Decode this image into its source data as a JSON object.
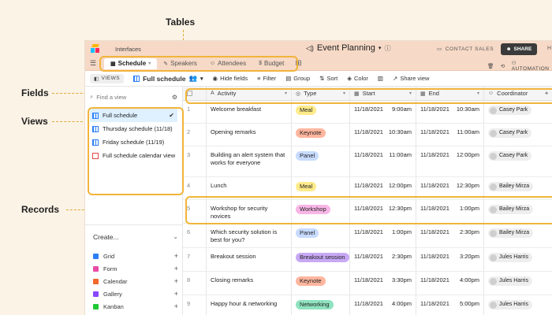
{
  "callouts": {
    "tables": "Tables",
    "fields": "Fields",
    "views": "Views",
    "records": "Records"
  },
  "topbar": {
    "interfaces": "Interfaces",
    "title": "Event Planning",
    "contact": "CONTACT SALES",
    "share": "SHARE",
    "help": "H"
  },
  "tabs": [
    {
      "label": "Schedule",
      "active": true
    },
    {
      "label": "Speakers",
      "active": false
    },
    {
      "label": "Attendees",
      "active": false
    },
    {
      "label": "Budget",
      "active": false
    }
  ],
  "automations": "AUTOMATION",
  "toolbar": {
    "views": "VIEWS",
    "view_name": "Full schedule",
    "hide": "Hide fields",
    "filter": "Filter",
    "group": "Group",
    "sort": "Sort",
    "color": "Color",
    "share_view": "Share view"
  },
  "sidebar": {
    "find_placeholder": "Find a view",
    "views": [
      {
        "label": "Full schedule",
        "selected": true,
        "type": "grid"
      },
      {
        "label": "Thursday schedule (11/18)",
        "selected": false,
        "type": "grid"
      },
      {
        "label": "Friday schedule (11/19)",
        "selected": false,
        "type": "grid"
      },
      {
        "label": "Full schedule calendar view",
        "selected": false,
        "type": "calendar"
      }
    ],
    "create": "Create...",
    "create_items": [
      {
        "label": "Grid",
        "color": "#2d7ff9"
      },
      {
        "label": "Form",
        "color": "#e84ba5"
      },
      {
        "label": "Calendar",
        "color": "#f2682a"
      },
      {
        "label": "Gallery",
        "color": "#8b46ff"
      },
      {
        "label": "Kanban",
        "color": "#20c933"
      }
    ]
  },
  "grid": {
    "columns": [
      "Activity",
      "Type",
      "Start",
      "End",
      "Coordinator"
    ],
    "rows": [
      {
        "n": "1",
        "activity": "Welcome breakfast",
        "type": "Meal",
        "start_date": "11/18/2021",
        "start_time": "9:00am",
        "end_date": "11/18/2021",
        "end_time": "10:30am",
        "coord": "Casey Park"
      },
      {
        "n": "2",
        "activity": "Opening remarks",
        "type": "Keynote",
        "start_date": "11/18/2021",
        "start_time": "10:30am",
        "end_date": "11/18/2021",
        "end_time": "11:00am",
        "coord": "Casey Park"
      },
      {
        "n": "3",
        "activity": "Building an alert system that works for everyone",
        "type": "Panel",
        "start_date": "11/18/2021",
        "start_time": "11:00am",
        "end_date": "11/18/2021",
        "end_time": "12:00pm",
        "coord": "Casey Park"
      },
      {
        "n": "4",
        "activity": "Lunch",
        "type": "Meal",
        "start_date": "11/18/2021",
        "start_time": "12:00pm",
        "end_date": "11/18/2021",
        "end_time": "12:30pm",
        "coord": "Bailey Mirza"
      },
      {
        "n": "5",
        "activity": "Workshop for security novices",
        "type": "Workshop",
        "start_date": "11/18/2021",
        "start_time": "12:30pm",
        "end_date": "11/18/2021",
        "end_time": "1:00pm",
        "coord": "Bailey Mirza"
      },
      {
        "n": "6",
        "activity": "Which security solution is best for you?",
        "type": "Panel",
        "start_date": "11/18/2021",
        "start_time": "1:00pm",
        "end_date": "11/18/2021",
        "end_time": "2:30pm",
        "coord": "Bailey Mirza"
      },
      {
        "n": "7",
        "activity": "Breakout session",
        "type": "Breakout session",
        "start_date": "11/18/2021",
        "start_time": "2:30pm",
        "end_date": "11/18/2021",
        "end_time": "3:20pm",
        "coord": "Jules Harris"
      },
      {
        "n": "8",
        "activity": "Closing remarks",
        "type": "Keynote",
        "start_date": "11/18/2021",
        "start_time": "3:30pm",
        "end_date": "11/18/2021",
        "end_time": "4:00pm",
        "coord": "Jules Harris"
      },
      {
        "n": "9",
        "activity": "Happy hour & networking",
        "type": "Networking",
        "start_date": "11/18/2021",
        "start_time": "4:00pm",
        "end_date": "11/18/2021",
        "end_time": "5:00pm",
        "coord": "Jules Harris"
      }
    ]
  },
  "type_colors": {
    "Meal": "#ffeb8a",
    "Keynote": "#ffb69e",
    "Panel": "#c7dbff",
    "Workshop": "#f8b6e6",
    "Breakout session": "#c8a9f5",
    "Networking": "#8fe3bf"
  },
  "accent": "#f2b43a"
}
